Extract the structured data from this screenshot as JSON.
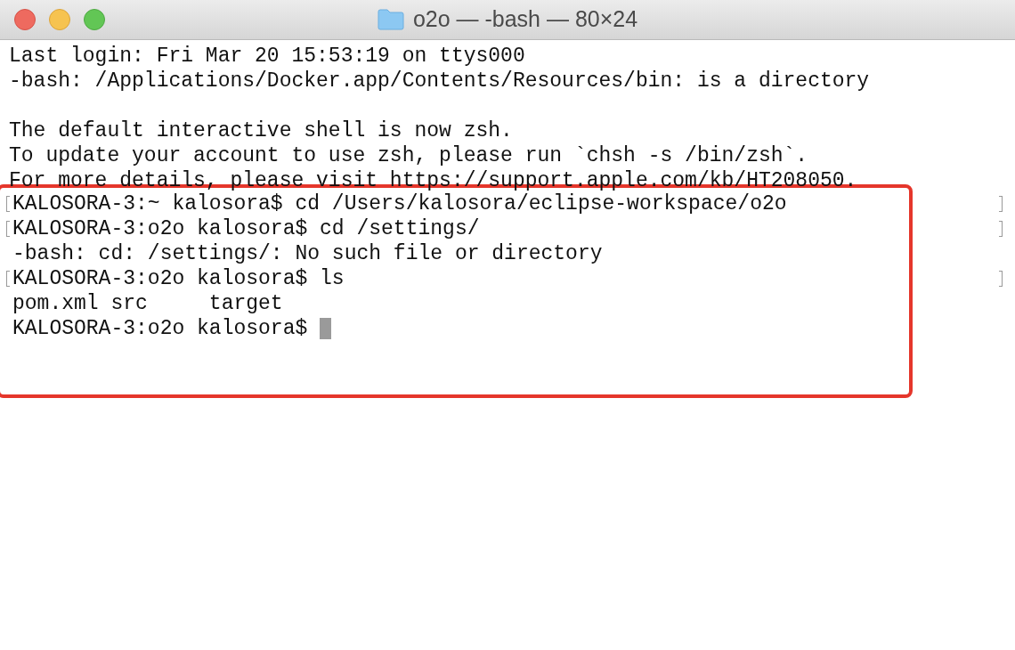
{
  "window": {
    "title": "o2o — -bash — 80×24"
  },
  "lines": [
    {
      "text": "Last login: Fri Mar 20 15:53:19 on ttys000",
      "marked": false
    },
    {
      "text": "-bash: /Applications/Docker.app/Contents/Resources/bin: is a directory",
      "marked": false
    },
    {
      "marked": false
    },
    {
      "text": "The default interactive shell is now zsh.",
      "marked": false
    },
    {
      "text": "To update your account to use zsh, please run `chsh -s /bin/zsh`.",
      "marked": false
    },
    {
      "text": "For more details, please visit https://support.apple.com/kb/HT208050.",
      "marked": false
    }
  ],
  "highlighted_lines": [
    {
      "text": "KALOSORA-3:~ kalosora$ cd /Users/kalosora/eclipse-workspace/o2o",
      "marked": true
    },
    {
      "text": "KALOSORA-3:o2o kalosora$ cd /settings/",
      "marked": true
    },
    {
      "text": "-bash: cd: /settings/: No such file or directory",
      "marked": false
    },
    {
      "text": "KALOSORA-3:o2o kalosora$ ls",
      "marked": true
    },
    {
      "text": "pom.xml src     target",
      "marked": false
    },
    {
      "text": "KALOSORA-3:o2o kalosora$ ",
      "marked": false,
      "cursor": true
    }
  ]
}
